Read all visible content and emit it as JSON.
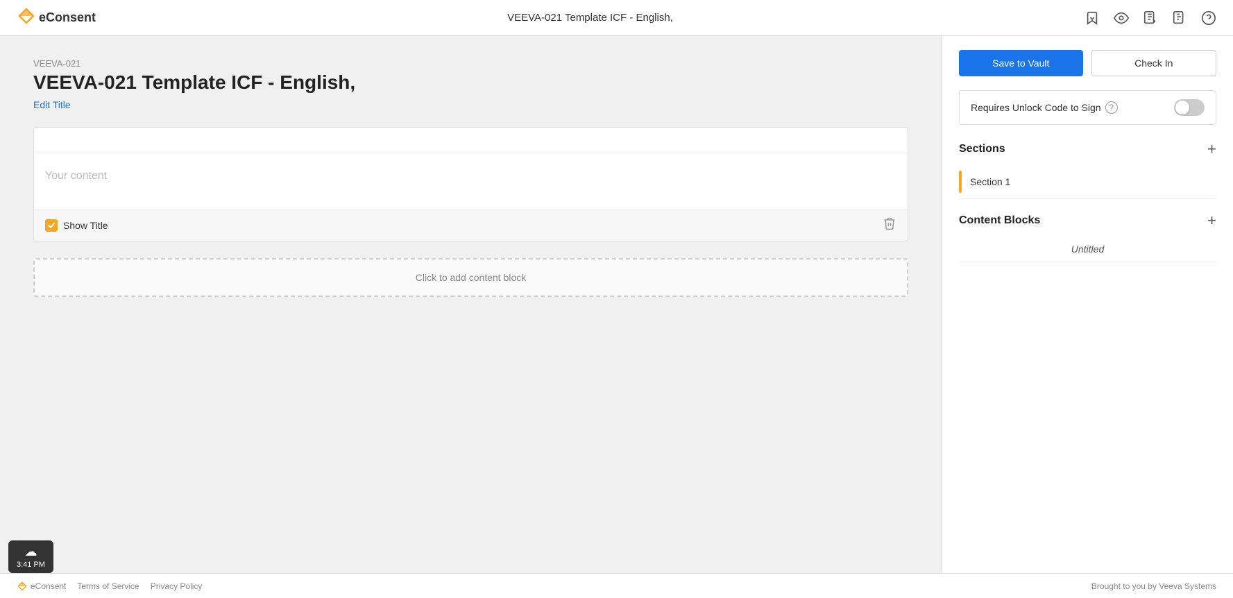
{
  "header": {
    "logo_text": "eConsent",
    "title": "VEEVA-021 Template ICF - English,",
    "icons": [
      "bookmark-icon",
      "eye-icon",
      "docx-icon",
      "pdf-icon",
      "help-icon"
    ]
  },
  "breadcrumb": "VEEVA-021",
  "doc_title": "VEEVA-021 Template ICF - English,",
  "edit_title_label": "Edit Title",
  "sidebar": {
    "save_label": "Save to Vault",
    "checkin_label": "Check In",
    "unlock_label": "Requires Unlock Code to Sign",
    "toggle_state": false,
    "sections_title": "Sections",
    "content_blocks_title": "Content Blocks",
    "section_items": [
      {
        "name": "Section 1"
      }
    ],
    "content_block_items": [
      {
        "name": "Untitled"
      }
    ]
  },
  "content_block": {
    "title_placeholder": "",
    "body_placeholder": "Your content",
    "show_title_label": "Show Title",
    "show_title_checked": true,
    "delete_tooltip": "Delete"
  },
  "add_block_label": "Click to add content block",
  "footer": {
    "logo_text": "eConsent",
    "links": [
      "Terms of Service",
      "Privacy Policy"
    ],
    "attribution": "Brought to you by Veeva Systems"
  },
  "status_bar": {
    "time": "3:41 PM"
  }
}
